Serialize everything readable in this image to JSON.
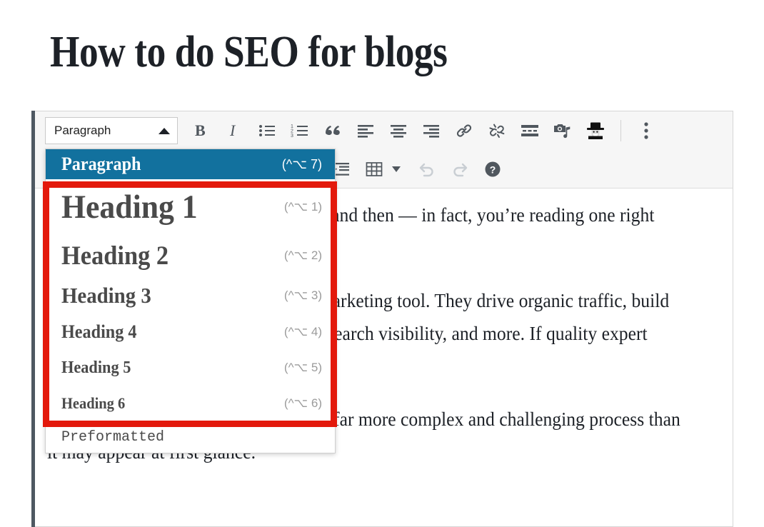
{
  "page": {
    "title": "How to do SEO for blogs"
  },
  "toolbar": {
    "style_select": {
      "value": "Paragraph",
      "caret_icon": "caret-up-icon"
    },
    "row1": [
      {
        "name": "bold-button",
        "icon": "bold-icon",
        "label": "B"
      },
      {
        "name": "italic-button",
        "icon": "italic-icon",
        "label": "I"
      },
      {
        "name": "bulleted-list-button",
        "icon": "bulleted-list-icon",
        "label": ""
      },
      {
        "name": "numbered-list-button",
        "icon": "numbered-list-icon",
        "label": ""
      },
      {
        "name": "blockquote-button",
        "icon": "blockquote-icon",
        "label": ""
      },
      {
        "name": "align-left-button",
        "icon": "align-left-icon",
        "label": ""
      },
      {
        "name": "align-center-button",
        "icon": "align-center-icon",
        "label": ""
      },
      {
        "name": "align-right-button",
        "icon": "align-right-icon",
        "label": ""
      },
      {
        "name": "insert-link-button",
        "icon": "link-icon",
        "label": ""
      },
      {
        "name": "remove-link-button",
        "icon": "unlink-icon",
        "label": ""
      },
      {
        "name": "insert-read-more-button",
        "icon": "read-more-icon",
        "label": ""
      },
      {
        "name": "insert-media-button",
        "icon": "media-icon",
        "label": ""
      },
      {
        "name": "yoast-seo-button",
        "icon": "yoast-wizard-icon",
        "label": ""
      },
      {
        "name": "toolbar-toggle-button",
        "icon": "kebab-menu-icon",
        "label": ""
      }
    ],
    "row2": [
      {
        "name": "indent-button",
        "icon": "indent-icon",
        "label": ""
      },
      {
        "name": "table-button",
        "icon": "table-icon",
        "label": ""
      },
      {
        "name": "table-dropdown-button",
        "icon": "caret-down-icon",
        "label": ""
      },
      {
        "name": "undo-button",
        "icon": "undo-icon",
        "label": "",
        "disabled": true
      },
      {
        "name": "redo-button",
        "icon": "redo-icon",
        "label": "",
        "disabled": true
      },
      {
        "name": "keyboard-shortcuts-button",
        "icon": "help-icon",
        "label": ""
      }
    ]
  },
  "style_menu": {
    "items": [
      {
        "label": "Paragraph",
        "shortcut": "(^⌥ 7)",
        "selected": true
      },
      {
        "label": "Heading 1",
        "shortcut": "(^⌥ 1)",
        "selected": false
      },
      {
        "label": "Heading 2",
        "shortcut": "(^⌥ 2)",
        "selected": false
      },
      {
        "label": "Heading 3",
        "shortcut": "(^⌥ 3)",
        "selected": false
      },
      {
        "label": "Heading 4",
        "shortcut": "(^⌥ 4)",
        "selected": false
      },
      {
        "label": "Heading 5",
        "shortcut": "(^⌥ 5)",
        "selected": false
      },
      {
        "label": "Heading 6",
        "shortcut": "(^⌥ 6)",
        "selected": false
      },
      {
        "label": "Preformatted",
        "shortcut": "",
        "selected": false
      }
    ]
  },
  "content": {
    "paragraphs": [
      "Everyone reads a blog post every now and then — in fact, you’re reading one right now.",
      "For businesses, blogs are a powerful marketing tool. They drive organic traffic, build authority, increase user trust, enhance search visibility, and more. If quality expert content is produced, that is.",
      "But creating an SEO-friendly blog is a far more complex and challenging process than it may appear at first glance."
    ]
  },
  "colors": {
    "highlight_blue": "#12719e",
    "annotation_red": "#e3190c",
    "toolbar_bg": "#f6f6f6",
    "rail_gray": "#4e5862"
  }
}
